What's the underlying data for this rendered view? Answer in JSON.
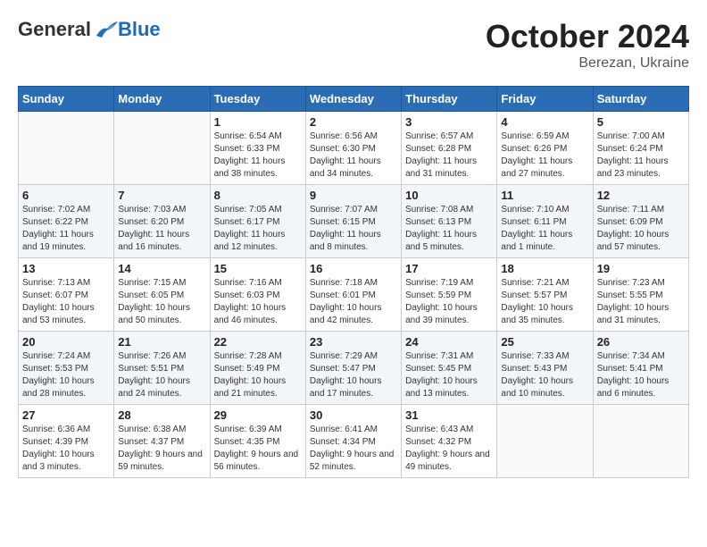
{
  "header": {
    "logo_general": "General",
    "logo_blue": "Blue",
    "month": "October 2024",
    "location": "Berezan, Ukraine"
  },
  "days_of_week": [
    "Sunday",
    "Monday",
    "Tuesday",
    "Wednesday",
    "Thursday",
    "Friday",
    "Saturday"
  ],
  "weeks": [
    [
      {
        "day": "",
        "info": ""
      },
      {
        "day": "",
        "info": ""
      },
      {
        "day": "1",
        "info": "Sunrise: 6:54 AM\nSunset: 6:33 PM\nDaylight: 11 hours and 38 minutes."
      },
      {
        "day": "2",
        "info": "Sunrise: 6:56 AM\nSunset: 6:30 PM\nDaylight: 11 hours and 34 minutes."
      },
      {
        "day": "3",
        "info": "Sunrise: 6:57 AM\nSunset: 6:28 PM\nDaylight: 11 hours and 31 minutes."
      },
      {
        "day": "4",
        "info": "Sunrise: 6:59 AM\nSunset: 6:26 PM\nDaylight: 11 hours and 27 minutes."
      },
      {
        "day": "5",
        "info": "Sunrise: 7:00 AM\nSunset: 6:24 PM\nDaylight: 11 hours and 23 minutes."
      }
    ],
    [
      {
        "day": "6",
        "info": "Sunrise: 7:02 AM\nSunset: 6:22 PM\nDaylight: 11 hours and 19 minutes."
      },
      {
        "day": "7",
        "info": "Sunrise: 7:03 AM\nSunset: 6:20 PM\nDaylight: 11 hours and 16 minutes."
      },
      {
        "day": "8",
        "info": "Sunrise: 7:05 AM\nSunset: 6:17 PM\nDaylight: 11 hours and 12 minutes."
      },
      {
        "day": "9",
        "info": "Sunrise: 7:07 AM\nSunset: 6:15 PM\nDaylight: 11 hours and 8 minutes."
      },
      {
        "day": "10",
        "info": "Sunrise: 7:08 AM\nSunset: 6:13 PM\nDaylight: 11 hours and 5 minutes."
      },
      {
        "day": "11",
        "info": "Sunrise: 7:10 AM\nSunset: 6:11 PM\nDaylight: 11 hours and 1 minute."
      },
      {
        "day": "12",
        "info": "Sunrise: 7:11 AM\nSunset: 6:09 PM\nDaylight: 10 hours and 57 minutes."
      }
    ],
    [
      {
        "day": "13",
        "info": "Sunrise: 7:13 AM\nSunset: 6:07 PM\nDaylight: 10 hours and 53 minutes."
      },
      {
        "day": "14",
        "info": "Sunrise: 7:15 AM\nSunset: 6:05 PM\nDaylight: 10 hours and 50 minutes."
      },
      {
        "day": "15",
        "info": "Sunrise: 7:16 AM\nSunset: 6:03 PM\nDaylight: 10 hours and 46 minutes."
      },
      {
        "day": "16",
        "info": "Sunrise: 7:18 AM\nSunset: 6:01 PM\nDaylight: 10 hours and 42 minutes."
      },
      {
        "day": "17",
        "info": "Sunrise: 7:19 AM\nSunset: 5:59 PM\nDaylight: 10 hours and 39 minutes."
      },
      {
        "day": "18",
        "info": "Sunrise: 7:21 AM\nSunset: 5:57 PM\nDaylight: 10 hours and 35 minutes."
      },
      {
        "day": "19",
        "info": "Sunrise: 7:23 AM\nSunset: 5:55 PM\nDaylight: 10 hours and 31 minutes."
      }
    ],
    [
      {
        "day": "20",
        "info": "Sunrise: 7:24 AM\nSunset: 5:53 PM\nDaylight: 10 hours and 28 minutes."
      },
      {
        "day": "21",
        "info": "Sunrise: 7:26 AM\nSunset: 5:51 PM\nDaylight: 10 hours and 24 minutes."
      },
      {
        "day": "22",
        "info": "Sunrise: 7:28 AM\nSunset: 5:49 PM\nDaylight: 10 hours and 21 minutes."
      },
      {
        "day": "23",
        "info": "Sunrise: 7:29 AM\nSunset: 5:47 PM\nDaylight: 10 hours and 17 minutes."
      },
      {
        "day": "24",
        "info": "Sunrise: 7:31 AM\nSunset: 5:45 PM\nDaylight: 10 hours and 13 minutes."
      },
      {
        "day": "25",
        "info": "Sunrise: 7:33 AM\nSunset: 5:43 PM\nDaylight: 10 hours and 10 minutes."
      },
      {
        "day": "26",
        "info": "Sunrise: 7:34 AM\nSunset: 5:41 PM\nDaylight: 10 hours and 6 minutes."
      }
    ],
    [
      {
        "day": "27",
        "info": "Sunrise: 6:36 AM\nSunset: 4:39 PM\nDaylight: 10 hours and 3 minutes."
      },
      {
        "day": "28",
        "info": "Sunrise: 6:38 AM\nSunset: 4:37 PM\nDaylight: 9 hours and 59 minutes."
      },
      {
        "day": "29",
        "info": "Sunrise: 6:39 AM\nSunset: 4:35 PM\nDaylight: 9 hours and 56 minutes."
      },
      {
        "day": "30",
        "info": "Sunrise: 6:41 AM\nSunset: 4:34 PM\nDaylight: 9 hours and 52 minutes."
      },
      {
        "day": "31",
        "info": "Sunrise: 6:43 AM\nSunset: 4:32 PM\nDaylight: 9 hours and 49 minutes."
      },
      {
        "day": "",
        "info": ""
      },
      {
        "day": "",
        "info": ""
      }
    ]
  ]
}
